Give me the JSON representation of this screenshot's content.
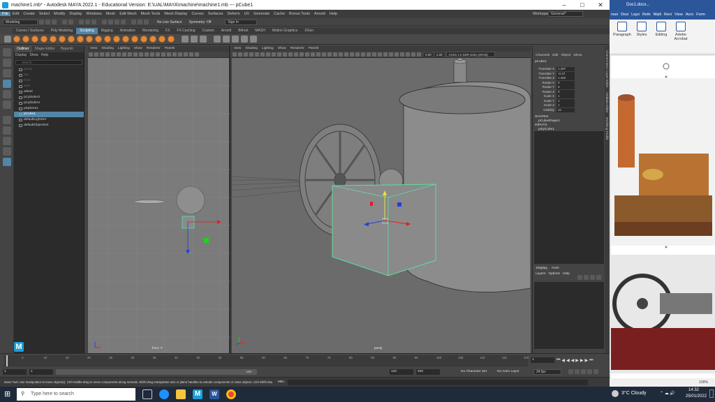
{
  "window": {
    "title": "machine1.mb* - Autodesk MAYA 2022.1 - Educational Version: E:\\UAL\\MAYA\\machine\\machine1.mb  ---  pCube1"
  },
  "menubar": [
    "File",
    "Edit",
    "Create",
    "Select",
    "Modify",
    "Display",
    "Windows",
    "Mesh",
    "Edit Mesh",
    "Mesh Tools",
    "Mesh Display",
    "Curves",
    "Surfaces",
    "Deform",
    "UV",
    "Generate",
    "Cache",
    "Bonus Tools",
    "Arnold",
    "Help"
  ],
  "workspace": {
    "label": "Workspace :",
    "value": "General*"
  },
  "statusline": {
    "mode": "Modeling",
    "live_surface": "No Live Surface",
    "symmetry": "Symmetry: Off",
    "signin": "Sign In"
  },
  "shelf_tabs": [
    "Curves / Surfaces",
    "Poly Modeling",
    "Sculpting",
    "Rigging",
    "Animation",
    "Rendering",
    "FX",
    "FX Caching",
    "Custom",
    "Arnold",
    "Bifrost",
    "MASH",
    "Motion Graphics",
    "XGen"
  ],
  "active_shelf_tab": "Sculpting",
  "outliner": {
    "tabs": [
      "Outliner",
      "Shape Editor",
      "Hypersh"
    ],
    "menus": [
      "Display",
      "Show",
      "Help"
    ],
    "search_placeholder": "Search...",
    "items": [
      {
        "label": "persp",
        "dim": true
      },
      {
        "label": "top",
        "dim": true
      },
      {
        "label": "front",
        "dim": true
      },
      {
        "label": "side",
        "dim": true
      },
      {
        "label": "wheel",
        "dim": false
      },
      {
        "label": "pCylinder3",
        "dim": false
      },
      {
        "label": "pCylinder4",
        "dim": false
      },
      {
        "label": "pSphere1",
        "dim": false
      },
      {
        "label": "pCube1",
        "dim": false
      },
      {
        "label": "defaultLightSet",
        "dim": false
      },
      {
        "label": "defaultObjectSet",
        "dim": false
      }
    ],
    "selected": "pCube1"
  },
  "viewports": {
    "menus": [
      "View",
      "Shading",
      "Lighting",
      "Show",
      "Renderer",
      "Panels"
    ],
    "front_label": "front -Y",
    "persp_label": "persp",
    "persp_values": {
      "near": "0.00",
      "far": "1.00",
      "colorspace": "ACES 1.0 SDR-video (sRGB)"
    }
  },
  "channelbox": {
    "menus": [
      "Channels",
      "Edit",
      "Object",
      "Show"
    ],
    "object": "pCube1",
    "attributes": [
      {
        "name": "Translate X",
        "value": "1.297"
      },
      {
        "name": "Translate Y",
        "value": "-0.47"
      },
      {
        "name": "Translate Z",
        "value": "1.462"
      },
      {
        "name": "Rotate X",
        "value": "0"
      },
      {
        "name": "Rotate Y",
        "value": "0"
      },
      {
        "name": "Rotate Z",
        "value": "0"
      },
      {
        "name": "Scale X",
        "value": "1"
      },
      {
        "name": "Scale Y",
        "value": "1"
      },
      {
        "name": "Scale Z",
        "value": "1"
      },
      {
        "name": "Visibility",
        "value": "on"
      }
    ],
    "shapes_header": "SHAPES",
    "shape": "pCubeShape1",
    "inputs_header": "INPUTS",
    "input": "polyCube1",
    "layer_tabs": [
      "Display",
      "Anim"
    ],
    "layer_menus": [
      "Layers",
      "Options",
      "Help"
    ]
  },
  "side_tabs": [
    "Channel Box / Layer Editor",
    "Attribute Editor",
    "Modeling Toolkit"
  ],
  "timeslider": {
    "ticks": [
      "5",
      "10",
      "15",
      "20",
      "25",
      "30",
      "35",
      "40",
      "45",
      "50",
      "55",
      "60",
      "65",
      "70",
      "75",
      "80",
      "85",
      "90",
      "95",
      "100",
      "105",
      "110",
      "115",
      "120"
    ],
    "current_frame": "1"
  },
  "rangeslider": {
    "start": "1",
    "start2": "1",
    "range_end": "120",
    "end": "120",
    "end2": "200",
    "character_set": "No Character Set",
    "anim_layer": "No Anim Layer",
    "fps": "24 fps"
  },
  "helpline": {
    "text": "Move Tool: Use manipulator to move object(s). Ctrl+middle-drag to move components along normals. Shift+drag manipulator axis or plane handles to extrude components or clone objects. Ctrl+Shift+drag to c m",
    "mel": "MEL"
  },
  "word": {
    "title": "Doc1.docx...",
    "tabs": [
      "nsei",
      "Desi",
      "Layo",
      "Refe",
      "Maili",
      "Revi",
      "View",
      "Acro",
      "Form"
    ],
    "ribbon": [
      "Paragraph",
      "Styles",
      "Editing",
      "Adobe Acrobat"
    ],
    "zoom": "100%"
  },
  "taskbar": {
    "search_placeholder": "Type here to search",
    "weather": "3°C Cloudy",
    "time": "14:32",
    "date": "25/01/2022"
  },
  "colors": {
    "accent": "#5285a6",
    "shelf_ball": "#e08a3a",
    "viewport_front": "#7b7b7b",
    "viewport_persp": "#6b6b6b",
    "selection_green": "#5be0a0",
    "word_blue": "#2b579a"
  }
}
